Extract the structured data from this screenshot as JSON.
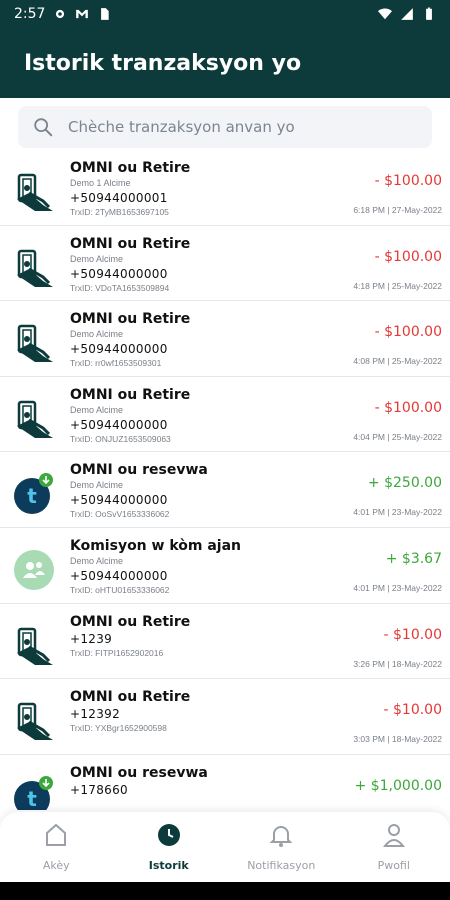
{
  "status": {
    "time": "2:57"
  },
  "header": {
    "title": "Istorik tranzaksyon yo"
  },
  "search": {
    "placeholder": "Chèche tranzaksyon anvan yo"
  },
  "transactions": [
    {
      "icon": "cash-withdraw-icon",
      "title": "OMNI ou Retire",
      "name": "Demo 1 Alcime",
      "phone": "+50944000001",
      "trx": "TrxID: 2TyMB1653697105",
      "amount": "- $100.00",
      "type": "neg",
      "date": "6:18 PM | 27-May-2022"
    },
    {
      "icon": "cash-withdraw-icon",
      "title": "OMNI ou Retire",
      "name": "Demo Alcime",
      "phone": "+50944000000",
      "trx": "TrxID: VDoTA1653509894",
      "amount": "- $100.00",
      "type": "neg",
      "date": "4:18 PM | 25-May-2022"
    },
    {
      "icon": "cash-withdraw-icon",
      "title": "OMNI ou Retire",
      "name": "Demo Alcime",
      "phone": "+50944000000",
      "trx": "TrxID: rr0wf1653509301",
      "amount": "- $100.00",
      "type": "neg",
      "date": "4:08 PM | 25-May-2022"
    },
    {
      "icon": "cash-withdraw-icon",
      "title": "OMNI ou Retire",
      "name": "Demo Alcime",
      "phone": "+50944000000",
      "trx": "TrxID: ONJUZ1653509063",
      "amount": "- $100.00",
      "type": "neg",
      "date": "4:04 PM | 25-May-2022"
    },
    {
      "icon": "reserve-coin-icon",
      "title": "OMNI ou resevwa",
      "name": "Demo Alcime",
      "phone": "+50944000000",
      "trx": "TrxID: OoSvV1653336062",
      "amount": "+ $250.00",
      "type": "pos",
      "date": "4:01 PM | 23-May-2022"
    },
    {
      "icon": "agent-commission-icon",
      "title": "Komisyon w kòm ajan",
      "name": "Demo Alcime",
      "phone": "+50944000000",
      "trx": "TrxID: oHTU01653336062",
      "amount": "+ $3.67",
      "type": "pos",
      "date": "4:01 PM | 23-May-2022"
    },
    {
      "icon": "cash-withdraw-icon",
      "title": "OMNI ou Retire",
      "name": "",
      "phone": "+1239",
      "trx": "TrxID: FITPI1652902016",
      "amount": "- $10.00",
      "type": "neg",
      "date": "3:26 PM | 18-May-2022"
    },
    {
      "icon": "cash-withdraw-icon",
      "title": "OMNI ou Retire",
      "name": "",
      "phone": "+12392",
      "trx": "TrxID: YXBgr1652900598",
      "amount": "- $10.00",
      "type": "neg",
      "date": "3:03 PM | 18-May-2022"
    },
    {
      "icon": "reserve-coin-icon",
      "title": "OMNI ou resevwa",
      "name": "",
      "phone": "+178660",
      "trx": "",
      "amount": "+ $1,000.00",
      "type": "pos",
      "date": ""
    }
  ],
  "nav": [
    {
      "label": "Akèy",
      "icon": "home-icon",
      "active": false
    },
    {
      "label": "Istorik",
      "icon": "history-icon",
      "active": true
    },
    {
      "label": "Notifikasyon",
      "icon": "bell-icon",
      "active": false
    },
    {
      "label": "Pwofil",
      "icon": "profile-icon",
      "active": false
    }
  ],
  "colors": {
    "primary": "#0d3b3b",
    "negative": "#e53935",
    "positive": "#3ca83c"
  }
}
